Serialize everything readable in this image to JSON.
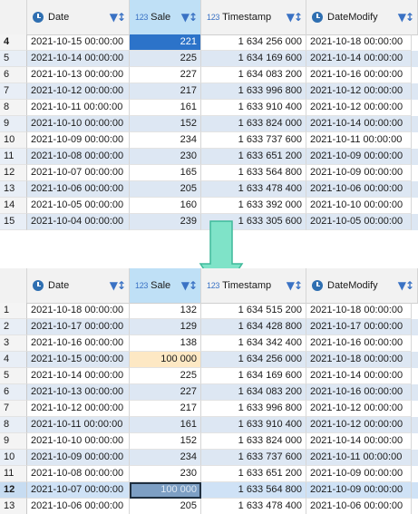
{
  "columns": {
    "date": "Date",
    "sale": "Sale",
    "sale_badge": "123",
    "timestamp": "Timestamp",
    "timestamp_badge": "123",
    "datemodify": "DateModify"
  },
  "top_grid": {
    "rows": [
      {
        "no": "4",
        "date": "2021-10-15 00:00:00",
        "sale": "221",
        "ts": "1 634 256 000",
        "dm": "2021-10-18 00:00:00"
      },
      {
        "no": "5",
        "date": "2021-10-14 00:00:00",
        "sale": "225",
        "ts": "1 634 169 600",
        "dm": "2021-10-14 00:00:00"
      },
      {
        "no": "6",
        "date": "2021-10-13 00:00:00",
        "sale": "227",
        "ts": "1 634 083 200",
        "dm": "2021-10-16 00:00:00"
      },
      {
        "no": "7",
        "date": "2021-10-12 00:00:00",
        "sale": "217",
        "ts": "1 633 996 800",
        "dm": "2021-10-12 00:00:00"
      },
      {
        "no": "8",
        "date": "2021-10-11 00:00:00",
        "sale": "161",
        "ts": "1 633 910 400",
        "dm": "2021-10-12 00:00:00"
      },
      {
        "no": "9",
        "date": "2021-10-10 00:00:00",
        "sale": "152",
        "ts": "1 633 824 000",
        "dm": "2021-10-14 00:00:00"
      },
      {
        "no": "10",
        "date": "2021-10-09 00:00:00",
        "sale": "234",
        "ts": "1 633 737 600",
        "dm": "2021-10-11 00:00:00"
      },
      {
        "no": "11",
        "date": "2021-10-08 00:00:00",
        "sale": "230",
        "ts": "1 633 651 200",
        "dm": "2021-10-09 00:00:00"
      },
      {
        "no": "12",
        "date": "2021-10-07 00:00:00",
        "sale": "165",
        "ts": "1 633 564 800",
        "dm": "2021-10-09 00:00:00"
      },
      {
        "no": "13",
        "date": "2021-10-06 00:00:00",
        "sale": "205",
        "ts": "1 633 478 400",
        "dm": "2021-10-06 00:00:00"
      },
      {
        "no": "14",
        "date": "2021-10-05 00:00:00",
        "sale": "160",
        "ts": "1 633 392 000",
        "dm": "2021-10-10 00:00:00"
      },
      {
        "no": "15",
        "date": "2021-10-04 00:00:00",
        "sale": "239",
        "ts": "1 633 305 600",
        "dm": "2021-10-05 00:00:00"
      }
    ]
  },
  "bottom_grid": {
    "rows": [
      {
        "no": "1",
        "date": "2021-10-18 00:00:00",
        "sale": "132",
        "ts": "1 634 515 200",
        "dm": "2021-10-18 00:00:00"
      },
      {
        "no": "2",
        "date": "2021-10-17 00:00:00",
        "sale": "129",
        "ts": "1 634 428 800",
        "dm": "2021-10-17 00:00:00"
      },
      {
        "no": "3",
        "date": "2021-10-16 00:00:00",
        "sale": "138",
        "ts": "1 634 342 400",
        "dm": "2021-10-16 00:00:00"
      },
      {
        "no": "4",
        "date": "2021-10-15 00:00:00",
        "sale": "100 000",
        "ts": "1 634 256 000",
        "dm": "2021-10-18 00:00:00"
      },
      {
        "no": "5",
        "date": "2021-10-14 00:00:00",
        "sale": "225",
        "ts": "1 634 169 600",
        "dm": "2021-10-14 00:00:00"
      },
      {
        "no": "6",
        "date": "2021-10-13 00:00:00",
        "sale": "227",
        "ts": "1 634 083 200",
        "dm": "2021-10-16 00:00:00"
      },
      {
        "no": "7",
        "date": "2021-10-12 00:00:00",
        "sale": "217",
        "ts": "1 633 996 800",
        "dm": "2021-10-12 00:00:00"
      },
      {
        "no": "8",
        "date": "2021-10-11 00:00:00",
        "sale": "161",
        "ts": "1 633 910 400",
        "dm": "2021-10-12 00:00:00"
      },
      {
        "no": "9",
        "date": "2021-10-10 00:00:00",
        "sale": "152",
        "ts": "1 633 824 000",
        "dm": "2021-10-14 00:00:00"
      },
      {
        "no": "10",
        "date": "2021-10-09 00:00:00",
        "sale": "234",
        "ts": "1 633 737 600",
        "dm": "2021-10-11 00:00:00"
      },
      {
        "no": "11",
        "date": "2021-10-08 00:00:00",
        "sale": "230",
        "ts": "1 633 651 200",
        "dm": "2021-10-09 00:00:00"
      },
      {
        "no": "12",
        "date": "2021-10-07 00:00:00",
        "sale": "100 000",
        "ts": "1 633 564 800",
        "dm": "2021-10-09 00:00:00"
      },
      {
        "no": "13",
        "date": "2021-10-06 00:00:00",
        "sale": "205",
        "ts": "1 633 478 400",
        "dm": "2021-10-06 00:00:00"
      }
    ]
  },
  "icons": {
    "date_column": "clock-icon",
    "datemodify_column": "clock-icon",
    "sort_filter": "filter-sort-icon",
    "arrow": "down-arrow-icon"
  },
  "colors": {
    "selected_cell": "#2c73c9",
    "edited_cell": "#fde8c4",
    "arrow": "#7fe3c8",
    "alt_row": "#dde7f3"
  }
}
